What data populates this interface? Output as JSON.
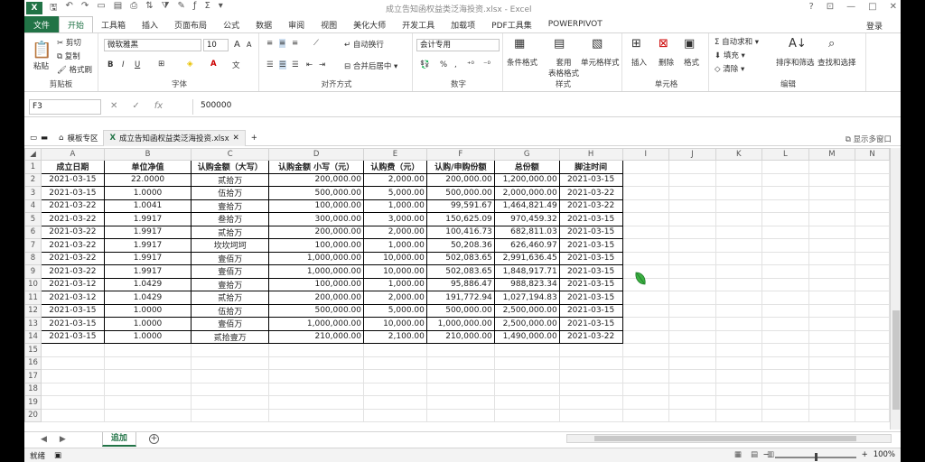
{
  "titlebar": {
    "title": "成立告知函权益类泛海投资.xlsx - Excel",
    "app_icon": "X",
    "help": "?",
    "min": "—",
    "restore": "□",
    "close": "✕"
  },
  "ribbon_tabs": {
    "file": "文件",
    "tabs": [
      "开始",
      "工具箱",
      "插入",
      "页面布局",
      "公式",
      "数据",
      "审阅",
      "视图",
      "美化大师",
      "开发工具",
      "加载项",
      "PDF工具集",
      "POWERPIVOT"
    ],
    "login": "登录"
  },
  "ribbon": {
    "clipboard": {
      "label": "剪贴板",
      "paste": "粘贴",
      "cut": "剪切",
      "copy": "复制",
      "format_painter": "格式刷"
    },
    "font": {
      "label": "字体",
      "font_name": "微软雅黑",
      "font_size": "10",
      "bold": "B",
      "italic": "I",
      "underline": "U",
      "grow": "A",
      "shrink": "A"
    },
    "alignment": {
      "label": "对齐方式",
      "wrap": "自动换行",
      "merge": "合并后居中"
    },
    "number": {
      "label": "数字",
      "format": "会计专用",
      "percent": "%",
      "comma": ","
    },
    "styles": {
      "label": "样式",
      "conditional": "条件格式",
      "table": "套用\n表格格式",
      "cell_styles": "单元格样式"
    },
    "cells": {
      "label": "单元格",
      "insert": "插入",
      "delete": "删除",
      "format": "格式"
    },
    "editing": {
      "label": "编辑",
      "autosum": "自动求和",
      "fill": "填充",
      "clear": "清除",
      "sort": "排序和筛选",
      "find": "查找和选择"
    }
  },
  "formula_bar": {
    "name_box": "F3",
    "cancel": "✕",
    "enter": "✓",
    "fx": "fx",
    "value": "500000"
  },
  "doc_tabs": {
    "template": "模板专区",
    "file": "成立告知函权益类泛海投资.xlsx",
    "close": "✕",
    "add": "+",
    "multi_window": "显示多窗口"
  },
  "columns": [
    "A",
    "B",
    "C",
    "D",
    "E",
    "F",
    "G",
    "H",
    "I",
    "J",
    "K",
    "L",
    "M",
    "N"
  ],
  "headers": [
    "成立日期",
    "单位净值",
    "认购金额（大写）",
    "认购金额 小写（元）",
    "认购费（元）",
    "认购/申购份额",
    "总份额",
    "脚注时间"
  ],
  "rows": [
    [
      "2021-03-15",
      "22.0000",
      "贰拾万",
      "200,000.00",
      "2,000.00",
      "200,000.00",
      "1,200,000.00",
      "2021-03-15"
    ],
    [
      "2021-03-15",
      "1.0000",
      "伍拾万",
      "500,000.00",
      "5,000.00",
      "500,000.00",
      "2,000,000.00",
      "2021-03-22"
    ],
    [
      "2021-03-22",
      "1.0041",
      "壹拾万",
      "100,000.00",
      "1,000.00",
      "99,591.67",
      "1,464,821.49",
      "2021-03-22"
    ],
    [
      "2021-03-22",
      "1.9917",
      "叁拾万",
      "300,000.00",
      "3,000.00",
      "150,625.09",
      "970,459.32",
      "2021-03-15"
    ],
    [
      "2021-03-22",
      "1.9917",
      "贰拾万",
      "200,000.00",
      "2,000.00",
      "100,416.73",
      "682,811.03",
      "2021-03-15"
    ],
    [
      "2021-03-22",
      "1.9917",
      "坎坎坷坷",
      "100,000.00",
      "1,000.00",
      "50,208.36",
      "626,460.97",
      "2021-03-15"
    ],
    [
      "2021-03-22",
      "1.9917",
      "壹佰万",
      "1,000,000.00",
      "10,000.00",
      "502,083.65",
      "2,991,636.45",
      "2021-03-15"
    ],
    [
      "2021-03-22",
      "1.9917",
      "壹佰万",
      "1,000,000.00",
      "10,000.00",
      "502,083.65",
      "1,848,917.71",
      "2021-03-15"
    ],
    [
      "2021-03-12",
      "1.0429",
      "壹拾万",
      "100,000.00",
      "1,000.00",
      "95,886.47",
      "988,823.34",
      "2021-03-15"
    ],
    [
      "2021-03-12",
      "1.0429",
      "贰拾万",
      "200,000.00",
      "2,000.00",
      "191,772.94",
      "1,027,194.83",
      "2021-03-15"
    ],
    [
      "2021-03-15",
      "1.0000",
      "伍拾万",
      "500,000.00",
      "5,000.00",
      "500,000.00",
      "2,500,000.00",
      "2021-03-15"
    ],
    [
      "2021-03-15",
      "1.0000",
      "壹佰万",
      "1,000,000.00",
      "10,000.00",
      "1,000,000.00",
      "2,500,000.00",
      "2021-03-15"
    ],
    [
      "2021-03-15",
      "1.0000",
      "贰拾壹万",
      "210,000.00",
      "2,100.00",
      "210,000.00",
      "1,490,000.00",
      "2021-03-22"
    ]
  ],
  "row_numbers": [
    "1",
    "2",
    "3",
    "4",
    "5",
    "6",
    "7",
    "8",
    "9",
    "10",
    "11",
    "12",
    "13",
    "14",
    "15",
    "16",
    "17",
    "18",
    "19",
    "20"
  ],
  "sheet_tabs": {
    "sheet": "追加",
    "add": "+"
  },
  "status": {
    "ready": "就绪",
    "zoom": "100%"
  }
}
